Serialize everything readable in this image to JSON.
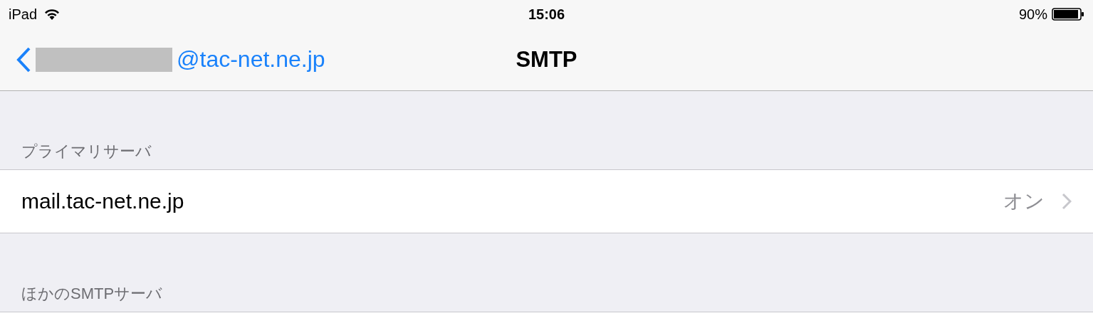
{
  "status_bar": {
    "device": "iPad",
    "time": "15:06",
    "battery": "90%"
  },
  "nav_bar": {
    "back_label": "@tac-net.ne.jp",
    "title": "SMTP"
  },
  "sections": [
    {
      "header": "プライマリサーバ",
      "rows": [
        {
          "label": "mail.tac-net.ne.jp",
          "value": "オン"
        }
      ]
    },
    {
      "header": "ほかのSMTPサーバ"
    }
  ]
}
